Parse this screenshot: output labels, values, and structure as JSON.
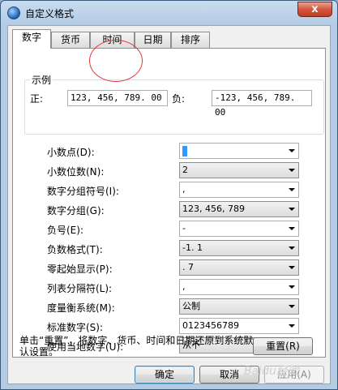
{
  "window": {
    "title": "自定义格式",
    "close_glyph": "x"
  },
  "tabs": [
    {
      "label": "数字",
      "active": true
    },
    {
      "label": "货币",
      "active": false
    },
    {
      "label": "时间",
      "active": false
    },
    {
      "label": "日期",
      "active": false
    },
    {
      "label": "排序",
      "active": false
    }
  ],
  "example": {
    "group_label": "示例",
    "positive_label": "正:",
    "positive_value": "123, 456, 789. 00",
    "negative_label": "负:",
    "negative_value": "-123, 456, 789. 00"
  },
  "settings": [
    {
      "label": "小数点(D):",
      "value": "",
      "style": "light"
    },
    {
      "label": "小数位数(N):",
      "value": "2",
      "style": "dark"
    },
    {
      "label": "数字分组符号(I):",
      "value": ",",
      "style": "light"
    },
    {
      "label": "数字分组(G):",
      "value": "123, 456, 789",
      "style": "dark"
    },
    {
      "label": "负号(E):",
      "value": "-",
      "style": "light"
    },
    {
      "label": "负数格式(T):",
      "value": "-1. 1",
      "style": "dark"
    },
    {
      "label": "零起始显示(P):",
      "value": ". 7",
      "style": "dark"
    },
    {
      "label": "列表分隔符(L):",
      "value": ",",
      "style": "light"
    },
    {
      "label": "度量衡系统(M):",
      "value": "公制",
      "style": "dark"
    },
    {
      "label": "标准数字(S):",
      "value": "0123456789",
      "style": "light"
    },
    {
      "label": "使用当地数字(U):",
      "value": "从不",
      "style": "dark"
    }
  ],
  "reset_note": "单击“重置”，将数字、货币、时间和日期还原到系统默认设置。",
  "buttons": {
    "reset": "重置(R)",
    "ok": "确定",
    "cancel": "取消",
    "apply": "应用(A)"
  },
  "watermark": "Baidu经验"
}
